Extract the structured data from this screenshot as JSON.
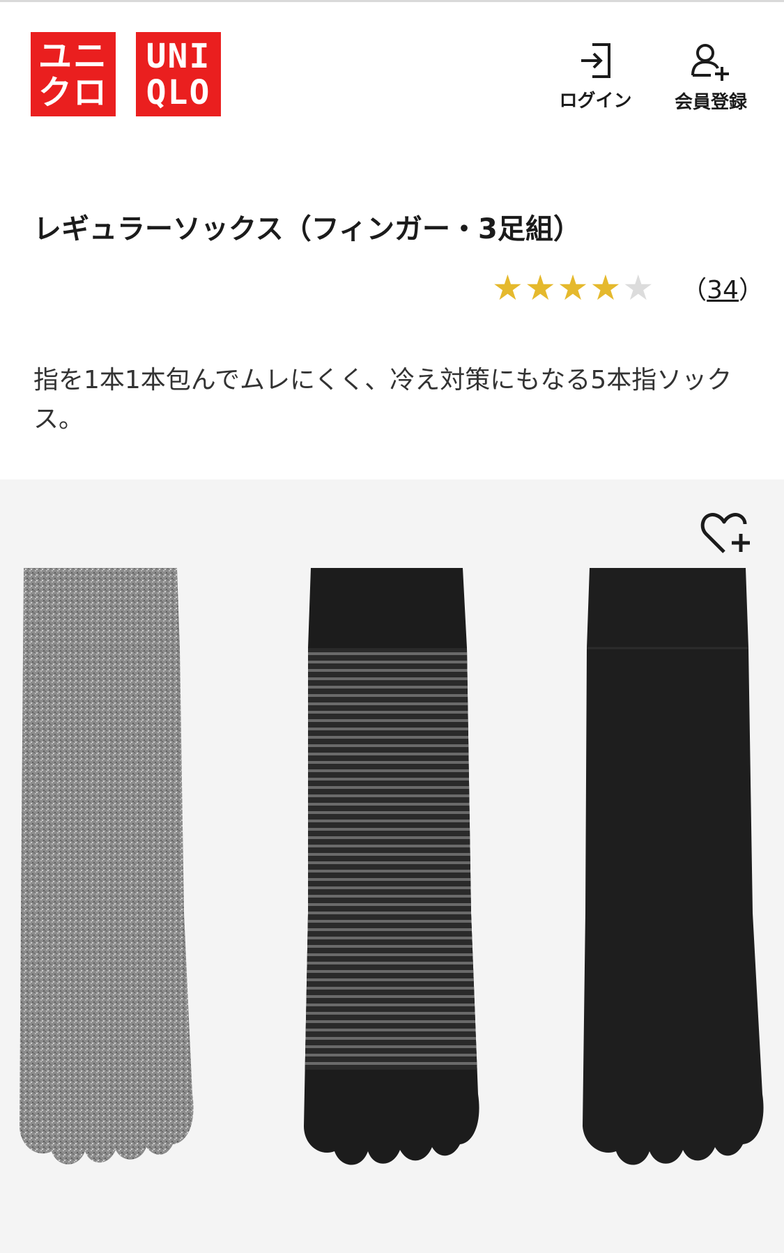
{
  "header": {
    "logo_katakana": [
      "ユニ",
      "クロ"
    ],
    "logo_latin": [
      "UNI",
      "QLO"
    ],
    "login_label": "ログイン",
    "register_label": "会員登録"
  },
  "product": {
    "title": "レギュラーソックス（フィンガー・3足組）",
    "rating": 4,
    "rating_max": 5,
    "review_count": "34",
    "description": "指を1本1本包んでムレにくく、冷え対策にもなる5本指ソックス。"
  },
  "gallery": {
    "wishlist_icon": "heart-plus-icon",
    "items": [
      {
        "name": "gray-heather-sock",
        "color": "#8a8a8a"
      },
      {
        "name": "striped-sock",
        "color": "#2b2b2b"
      },
      {
        "name": "black-sock",
        "color": "#1c1c1c"
      }
    ]
  },
  "colors": {
    "brand": "#ea1f1f",
    "star": "#e5b92d"
  }
}
